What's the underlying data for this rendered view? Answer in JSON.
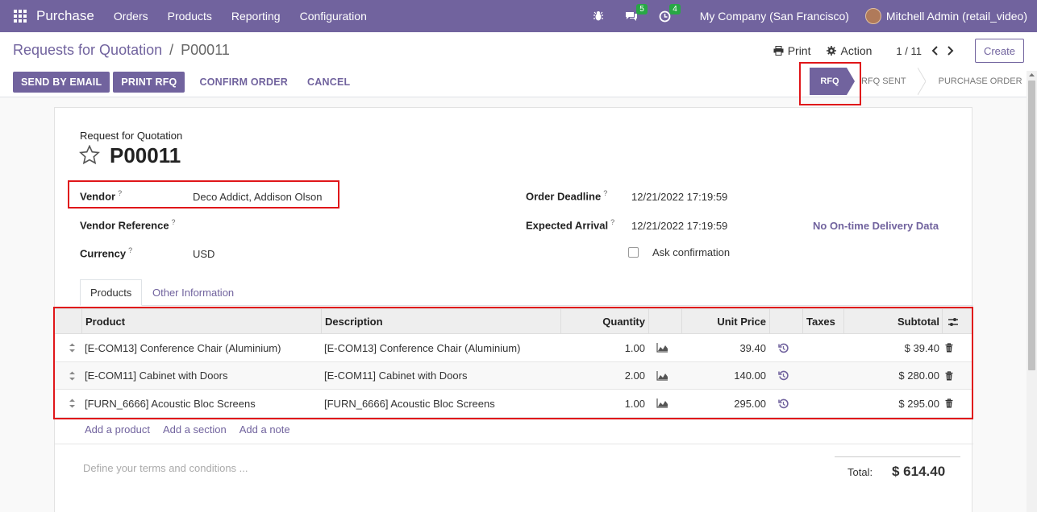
{
  "navbar": {
    "brand": "Purchase",
    "menu": [
      "Orders",
      "Products",
      "Reporting",
      "Configuration"
    ],
    "messages_count": "5",
    "activities_count": "4",
    "company": "My Company (San Francisco)",
    "user": "Mitchell Admin (retail_video)"
  },
  "control": {
    "breadcrumb_parent": "Requests for Quotation",
    "breadcrumb_sep": "/",
    "breadcrumb_current": "P00011",
    "print_label": "Print",
    "action_label": "Action",
    "pager": "1 / 11",
    "create_label": "Create",
    "buttons": {
      "send_email": "SEND BY EMAIL",
      "print_rfq": "PRINT RFQ",
      "confirm": "CONFIRM ORDER",
      "cancel": "CANCEL"
    },
    "status": {
      "active": "RFQ",
      "step1": "RFQ SENT",
      "step2": "PURCHASE ORDER"
    }
  },
  "form": {
    "subtitle": "Request for Quotation",
    "name": "P00011",
    "vendor_label": "Vendor",
    "vendor_value": "Deco Addict, Addison Olson",
    "vendor_ref_label": "Vendor Reference",
    "currency_label": "Currency",
    "currency_value": "USD",
    "deadline_label": "Order Deadline",
    "deadline_value": "12/21/2022 17:19:59",
    "arrival_label": "Expected Arrival",
    "arrival_value": "12/21/2022 17:19:59",
    "ontime": "No On-time Delivery Data",
    "ask_confirmation": "Ask confirmation",
    "help_mark": "?"
  },
  "tabs": {
    "products": "Products",
    "other": "Other Information"
  },
  "table": {
    "headers": {
      "product": "Product",
      "description": "Description",
      "quantity": "Quantity",
      "unit_price": "Unit Price",
      "taxes": "Taxes",
      "subtotal": "Subtotal"
    },
    "rows": [
      {
        "product": "[E-COM13] Conference Chair (Aluminium)",
        "description": "[E-COM13] Conference Chair (Aluminium)",
        "quantity": "1.00",
        "unit_price": "39.40",
        "subtotal": "$ 39.40"
      },
      {
        "product": "[E-COM11] Cabinet with Doors",
        "description": "[E-COM11] Cabinet with Doors",
        "quantity": "2.00",
        "unit_price": "140.00",
        "subtotal": "$ 280.00"
      },
      {
        "product": "[FURN_6666] Acoustic Bloc Screens",
        "description": "[FURN_6666] Acoustic Bloc Screens",
        "quantity": "1.00",
        "unit_price": "295.00",
        "subtotal": "$ 295.00"
      }
    ],
    "add_product": "Add a product",
    "add_section": "Add a section",
    "add_note": "Add a note"
  },
  "footer": {
    "terms_placeholder": "Define your terms and conditions ...",
    "total_label": "Total:",
    "total_value": "$ 614.40"
  },
  "colors": {
    "brand": "#71639e",
    "highlight": "#e0161a"
  }
}
